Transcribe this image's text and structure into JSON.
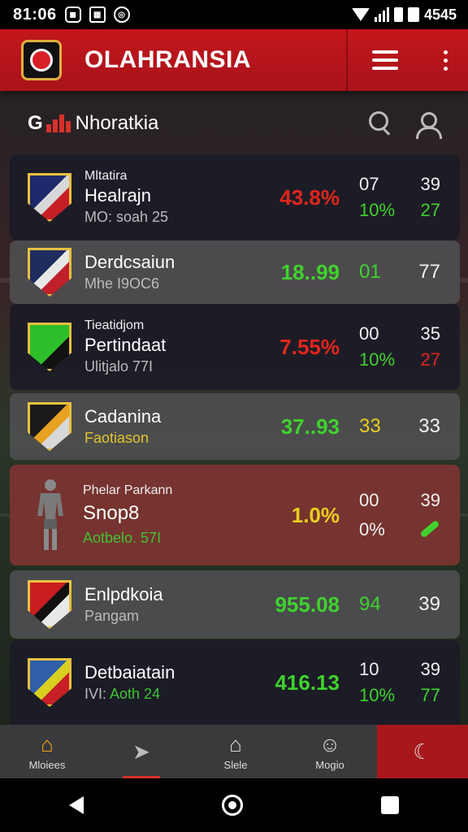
{
  "status_bar": {
    "time": "81:06",
    "battery_text": "4545",
    "left_icons": [
      "notification-icon",
      "app-icon",
      "alarm-icon"
    ]
  },
  "header": {
    "title": "OLAHRANSIA",
    "accent_color": "#c3161c"
  },
  "sub_header": {
    "prefix": "G",
    "title": "Nhoratkia"
  },
  "rows": [
    {
      "small": "Mltatira",
      "name": "Healrajn",
      "sub": "MO: soah 25",
      "pct": "43.8%",
      "pct_color": "red",
      "top": [
        "07",
        "39"
      ],
      "bottom": [
        "10%",
        "27"
      ],
      "bottom_colors": [
        "green",
        "green"
      ],
      "style": "dark",
      "crest": [
        "#1e2a6b",
        "#d8d8d8",
        "#c62026"
      ]
    },
    {
      "small": "",
      "name": "Derdcsaiun",
      "sub": "Mhe I9OC6",
      "pct": "18..99",
      "pct_color": "green",
      "top": [
        "01",
        "77"
      ],
      "bottom": [],
      "top_colors": [
        "green",
        "white"
      ],
      "style": "light",
      "crest": [
        "#1f2c5e",
        "#e8e8e8",
        "#c0202a"
      ]
    },
    {
      "small": "Tieatidjom",
      "name": "Pertindaat",
      "sub": "Ulitjalo  77I",
      "pct": "7.55%",
      "pct_color": "red",
      "top": [
        "00",
        "35"
      ],
      "bottom": [
        "10%",
        "27"
      ],
      "bottom_colors": [
        "green",
        "red"
      ],
      "style": "dark",
      "crest": [
        "#2fbf2a",
        "#2fbf2a",
        "#111"
      ]
    },
    {
      "small": "",
      "name": "Cadanina",
      "sub": "Faotiason",
      "pct": "37..93",
      "pct_color": "green",
      "top": [
        "33",
        "33"
      ],
      "bottom": [],
      "top_colors": [
        "yellow",
        "white"
      ],
      "style": "light",
      "crest": [
        "#1a1a1a",
        "#e8a020",
        "#d8d8d8"
      ]
    },
    {
      "small": "Phelar Parkann",
      "name": "Snop8",
      "sub": "Aotbelo. 57I",
      "pct": "1.0%",
      "pct_color": "yellow",
      "top": [
        "00",
        "39"
      ],
      "bottom": [
        "0%",
        "check"
      ],
      "bottom_colors": [
        "white",
        "green"
      ],
      "style": "red",
      "crest": [
        "#8a8a8a",
        "#6b6b6b",
        "#444"
      ]
    },
    {
      "small": "",
      "name": "Enlpdkoia",
      "sub": "Pangam",
      "pct": "955.08",
      "pct_color": "green",
      "top": [
        "94",
        "39"
      ],
      "bottom": [],
      "top_colors": [
        "green",
        "white"
      ],
      "style": "light",
      "crest": [
        "#c81e20",
        "#111",
        "#e8e8e8"
      ]
    },
    {
      "small": "",
      "name": "Detbaiatain",
      "sub": "IVI: Aoth 24",
      "pct": "416.13",
      "pct_color": "green",
      "top": [
        "10",
        "39"
      ],
      "bottom": [
        "10%",
        "77"
      ],
      "bottom_colors": [
        "green",
        "green"
      ],
      "style": "dark",
      "crest": [
        "#2e5fa8",
        "#d8d020",
        "#c62026"
      ]
    }
  ],
  "bottom_nav": [
    {
      "label": "Mloiees",
      "icon": "home-icon"
    },
    {
      "label": "",
      "icon": "send-icon"
    },
    {
      "label": "Slele",
      "icon": "house-outline-icon"
    },
    {
      "label": "Mogio",
      "icon": "people-icon"
    },
    {
      "label": "",
      "icon": "moon-icon"
    }
  ]
}
